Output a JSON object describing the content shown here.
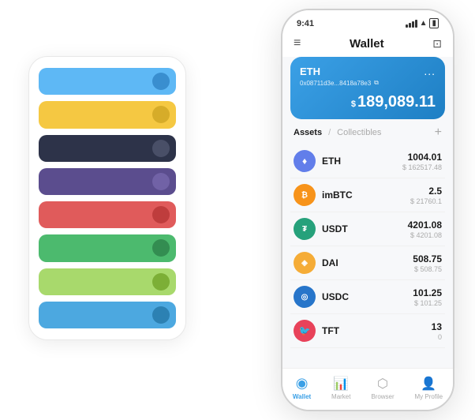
{
  "scene": {
    "bg_card": {
      "rows": [
        {
          "color": "row-blue",
          "dot_color": "#3d8fd1"
        },
        {
          "color": "row-yellow",
          "dot_color": "#c9a000"
        },
        {
          "color": "row-dark",
          "dot_color": "#555"
        },
        {
          "color": "row-purple",
          "dot_color": "#7b6bb0"
        },
        {
          "color": "row-red",
          "dot_color": "#b03030"
        },
        {
          "color": "row-green",
          "dot_color": "#2a7a44"
        },
        {
          "color": "row-lightgreen",
          "dot_color": "#6a9c20"
        },
        {
          "color": "row-skyblue",
          "dot_color": "#2070a0"
        }
      ]
    },
    "phone": {
      "status_time": "9:41",
      "header_title": "Wallet",
      "eth_card": {
        "label": "ETH",
        "address": "0x08711d3e...8418a78e3",
        "copy_icon": "⊞",
        "dots": "...",
        "dollar_sign": "$",
        "balance": "189,089.11"
      },
      "assets_section": {
        "tab_active": "Assets",
        "separator": "/",
        "tab_inactive": "Collectibles",
        "add_label": "+"
      },
      "assets": [
        {
          "name": "ETH",
          "icon_text": "♦",
          "icon_class": "eth-icon",
          "primary": "1004.01",
          "secondary": "$ 162517.48"
        },
        {
          "name": "imBTC",
          "icon_text": "₿",
          "icon_class": "imbtc-icon",
          "primary": "2.5",
          "secondary": "$ 21760.1"
        },
        {
          "name": "USDT",
          "icon_text": "₮",
          "icon_class": "usdt-icon",
          "primary": "4201.08",
          "secondary": "$ 4201.08"
        },
        {
          "name": "DAI",
          "icon_text": "◈",
          "icon_class": "dai-icon",
          "primary": "508.75",
          "secondary": "$ 508.75"
        },
        {
          "name": "USDC",
          "icon_text": "◎",
          "icon_class": "usdc-icon",
          "primary": "101.25",
          "secondary": "$ 101.25"
        },
        {
          "name": "TFT",
          "icon_text": "🐦",
          "icon_class": "tft-icon",
          "primary": "13",
          "secondary": "0"
        }
      ],
      "bottom_nav": [
        {
          "label": "Wallet",
          "icon": "◉",
          "active": true
        },
        {
          "label": "Market",
          "icon": "📈",
          "active": false
        },
        {
          "label": "Browser",
          "icon": "👤",
          "active": false
        },
        {
          "label": "My Profile",
          "icon": "👤",
          "active": false
        }
      ]
    }
  }
}
